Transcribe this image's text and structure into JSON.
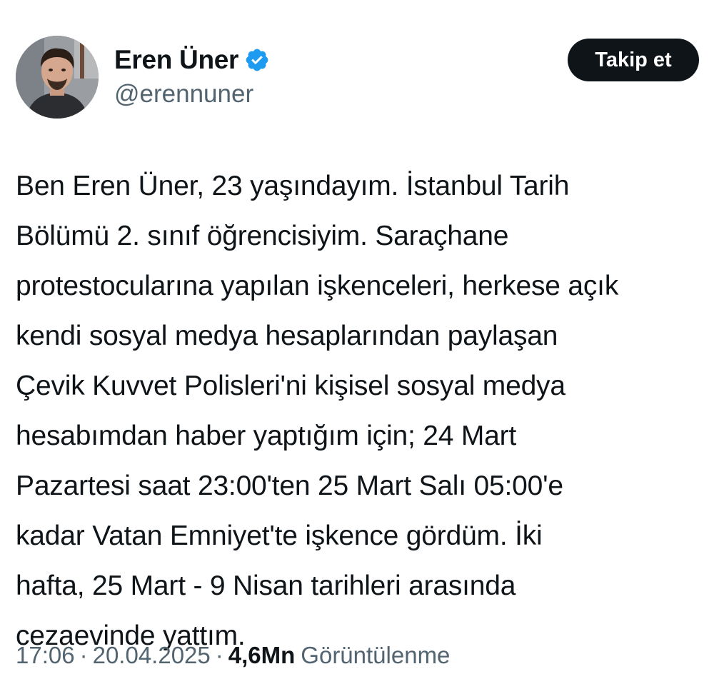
{
  "author": {
    "display_name": "Eren Üner",
    "handle": "@erennuner",
    "verified": true,
    "verified_color": "#1d9bf0"
  },
  "follow_button": {
    "label": "Takip et"
  },
  "tweet": {
    "lines": [
      "Ben Eren Üner, 23 yaşındayım. İstanbul Tarih",
      "Bölümü 2. sınıf öğrencisiyim. Saraçhane",
      "protestocularına yapılan işkenceleri, herkese açık",
      "kendi sosyal medya hesaplarından paylaşan",
      "Çevik Kuvvet Polisleri'ni kişisel sosyal medya",
      "hesabımdan haber yaptığım için; 24 Mart",
      "Pazartesi saat 23:00'ten 25 Mart Salı 05:00'e",
      "kadar Vatan Emniyet'te işkence gördüm. İki",
      "hafta, 25 Mart - 9 Nisan tarihleri arasında",
      "cezaevinde yattım."
    ]
  },
  "meta": {
    "time": "17:06",
    "separator": "·",
    "date": "20.04.2025",
    "views_count": "4,6Mn",
    "views_label": "Görüntülenme"
  },
  "icons": {
    "verified_badge": "verified-badge-icon"
  },
  "colors": {
    "text_primary": "#0f1419",
    "text_secondary": "#536471",
    "button_bg": "#0f1419",
    "button_text": "#ffffff"
  }
}
